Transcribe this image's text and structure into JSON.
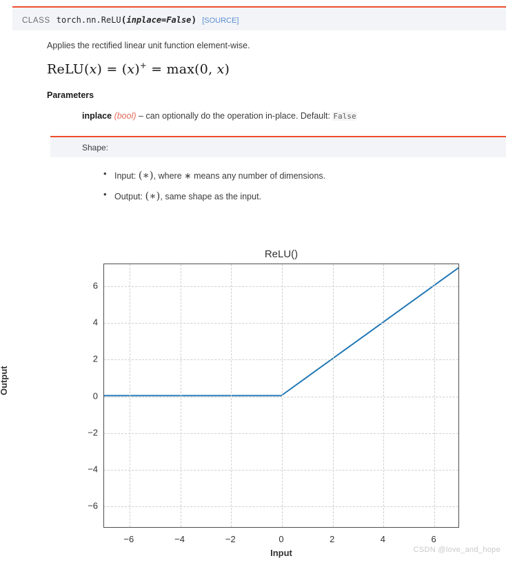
{
  "signature": {
    "prefix": "CLASS",
    "qualname": "torch.nn.ReLU",
    "open_paren": "(",
    "param": "inplace=False",
    "close_paren": ")",
    "source_link": "[SOURCE]"
  },
  "description": "Applies the rectified linear unit function element-wise.",
  "formula": {
    "lhs": "ReLU(",
    "var1": "x",
    "mid1": ") = (",
    "var2": "x",
    "mid2": ")",
    "sup": "+",
    "mid3": " = max(0, ",
    "var3": "x",
    "end": ")",
    "plain": "ReLU(x) = (x)+ = max(0, x)"
  },
  "parameters": {
    "heading": "Parameters",
    "name": "inplace",
    "type": "(bool)",
    "dash": "– can optionally do the operation in-place. Default:",
    "default": "False"
  },
  "shape": {
    "heading": "Shape:",
    "items": [
      {
        "prefix": "Input: ",
        "sym": "(∗)",
        "rest": ", where ∗ means any number of dimensions."
      },
      {
        "prefix": "Output: ",
        "sym": "(∗)",
        "rest": ", same shape as the input."
      }
    ]
  },
  "watermark": "CSDN @love_and_hope",
  "colors": {
    "accent_red": "#ee4c2c",
    "line_blue": "#1f77b4",
    "box_gray": "#f3f4f7",
    "link_blue": "#5b8fd4"
  },
  "chart_data": {
    "type": "line",
    "title": "ReLU()",
    "xlabel": "Input",
    "ylabel": "Output",
    "xlim": [
      -7,
      7
    ],
    "ylim": [
      -7.2,
      7.2
    ],
    "grid": true,
    "legend": null,
    "xticks": [
      -6,
      -4,
      -2,
      0,
      2,
      4,
      6
    ],
    "xticklabels": [
      "−6",
      "−4",
      "−2",
      "0",
      "2",
      "4",
      "6"
    ],
    "yticks": [
      -6,
      -4,
      -2,
      0,
      2,
      4,
      6
    ],
    "yticklabels": [
      "−6",
      "−4",
      "−2",
      "0",
      "2",
      "4",
      "6"
    ],
    "series": [
      {
        "name": "ReLU(x)",
        "color": "#1f77b4",
        "linewidth": 2,
        "x": [
          -7,
          -6,
          -5,
          -4,
          -3,
          -2,
          -1,
          0,
          1,
          2,
          3,
          4,
          5,
          6,
          7
        ],
        "y": [
          0,
          0,
          0,
          0,
          0,
          0,
          0,
          0,
          1,
          2,
          3,
          4,
          5,
          6,
          7
        ]
      }
    ]
  }
}
